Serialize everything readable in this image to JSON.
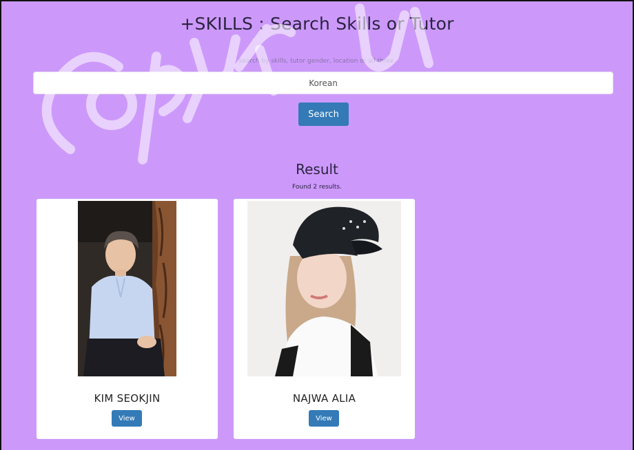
{
  "header": {
    "title": "+SKILLS : Search Skills or Tutor",
    "hint": "Search by skills, tutor gender, location or all three."
  },
  "search": {
    "value": "Korean",
    "button_label": "Search"
  },
  "results": {
    "heading": "Result",
    "count_text": "Found 2 results.",
    "cards": [
      {
        "name": "KIM SEOKJIN",
        "button_label": "View"
      },
      {
        "name": "NAJWA ALIA",
        "button_label": "View"
      }
    ]
  },
  "watermark": {
    "text": "Copyright UiTM"
  },
  "colors": {
    "background": "#cc99fb",
    "button": "#337ab7",
    "card": "#ffffff"
  }
}
